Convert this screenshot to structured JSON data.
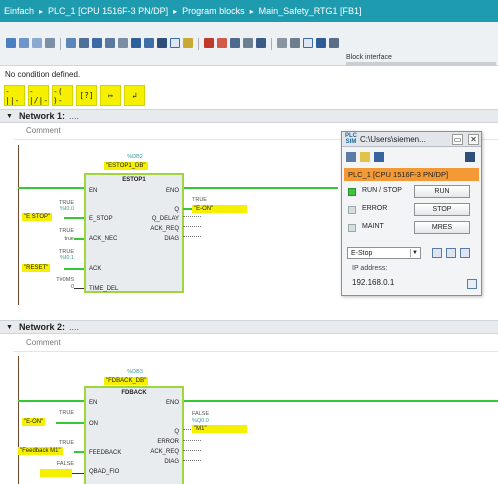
{
  "breadcrumb": {
    "items": [
      "Einfach",
      "PLC_1 [CPU 1516F-3 PN/DP]",
      "Program blocks",
      "Main_Safety_RTG1 [FB1]"
    ],
    "separator": "▸"
  },
  "toolbar": {
    "block_interface_label": "Block interface",
    "status_message": "No condition defined."
  },
  "ladder_toolbar": {
    "buttons": [
      "-||-",
      "-|/|-",
      "-( )-",
      "[?]",
      "↦",
      "↲"
    ]
  },
  "network1": {
    "label": "Network 1:",
    "dots": "....",
    "comment": "Comment",
    "block": {
      "instance_addr": "%DB2",
      "instance_name": "\"ESTOP1_DB\"",
      "type": "ESTOP1",
      "pins_in": [
        "EN",
        "E_STOP",
        "ACK_NEC",
        "ACK",
        "TIME_DEL"
      ],
      "pins_out": [
        "ENO",
        "Q",
        "Q_DELAY",
        "ACK_REQ",
        "DIAG"
      ],
      "in_values": {
        "estop": {
          "value": "TRUE",
          "addr": "%I0.0",
          "name": "\"E STOP\""
        },
        "ack_nec": {
          "value": "TRUE",
          "addr": "",
          "name": "true"
        },
        "ack": {
          "value": "TRUE",
          "addr": "%I0.1",
          "name": "\"RESET\""
        },
        "time_del": {
          "value": "T#0MS",
          "addr": "",
          "name": "0"
        }
      },
      "out_q": {
        "value": "TRUE",
        "addr": "",
        "name": "\"E-ON\""
      }
    }
  },
  "network2": {
    "label": "Network 2:",
    "dots": "....",
    "comment": "Comment",
    "block": {
      "instance_addr": "%DB3",
      "instance_name": "\"FDBACK_DB\"",
      "type": "FDBACK",
      "pins_in": [
        "EN",
        "ON",
        "FEEDBACK",
        "QBAD_FIO"
      ],
      "pins_out": [
        "ENO",
        "Q",
        "ERROR",
        "ACK_REQ",
        "DIAG"
      ],
      "in_values": {
        "on": {
          "value": "TRUE",
          "addr": "",
          "name": "\"E-ON\""
        },
        "feedback": {
          "value": "TRUE",
          "addr": "",
          "name": "\"Feedback M1\""
        },
        "qbad": {
          "value": "FALSE",
          "addr": "",
          "name": ""
        }
      },
      "out_q": {
        "value": "FALSE",
        "addr": "%Q0.0",
        "name": "\"M1\""
      }
    }
  },
  "plc_panel": {
    "title": "C:\\Users\\siemen...",
    "logo_line1": "PLC",
    "logo_line2": "SIM",
    "cpu": "PLC_1 [CPU 1516F-3 PN/DP]",
    "rows": [
      {
        "label": "RUN / STOP",
        "led": "on",
        "button": "RUN"
      },
      {
        "label": "ERROR",
        "led": "off",
        "button": "STOP"
      },
      {
        "label": "MAINT",
        "led": "off",
        "button": "MRES"
      }
    ],
    "select_value": "E-Stop",
    "ip_label": "IP address:",
    "ip_value": "192.168.0.1"
  }
}
